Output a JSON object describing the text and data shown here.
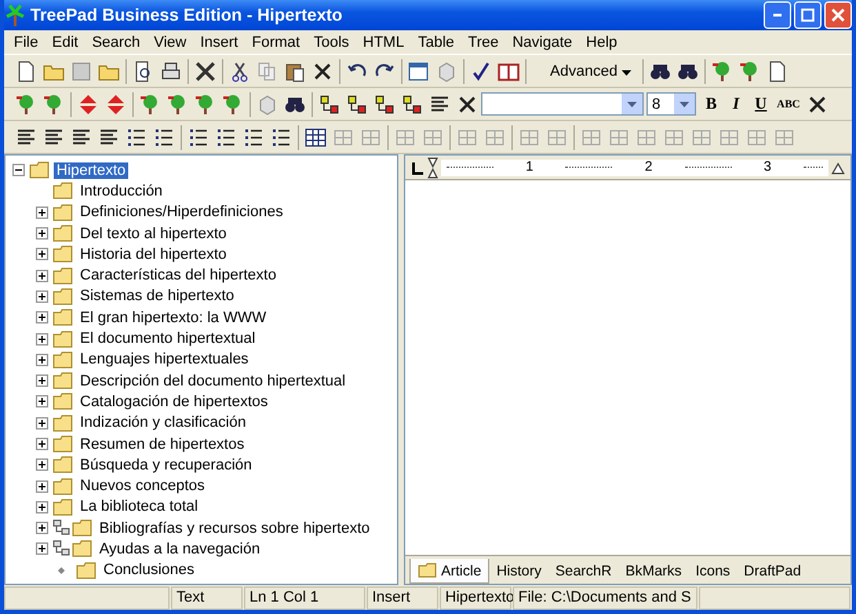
{
  "window": {
    "title": "TreePad Business Edition - Hipertexto"
  },
  "menu": [
    "File",
    "Edit",
    "Search",
    "View",
    "Insert",
    "Format",
    "Tools",
    "HTML",
    "Table",
    "Tree",
    "Navigate",
    "Help"
  ],
  "toolbar": {
    "search_mode": "Advanced",
    "font_size": "8",
    "bold": "B",
    "italic": "I",
    "underline": "U",
    "caps": "ABC"
  },
  "tree": {
    "label": "Hipertexto",
    "selected": true,
    "expanded": true,
    "children": [
      {
        "label": "Introducción",
        "kind": "plain",
        "selected": false
      },
      {
        "label": "Definiciones/Hiperdefiniciones",
        "kind": "folder",
        "selected": false
      },
      {
        "label": "Del texto al hipertexto",
        "kind": "folder",
        "selected": false
      },
      {
        "label": "Historia del hipertexto",
        "kind": "folder",
        "selected": false
      },
      {
        "label": "Características del hipertexto",
        "kind": "folder",
        "selected": false
      },
      {
        "label": "Sistemas de hipertexto",
        "kind": "folder",
        "selected": false
      },
      {
        "label": "El gran hipertexto: la WWW",
        "kind": "folder",
        "selected": false
      },
      {
        "label": "El documento hipertextual",
        "kind": "folder",
        "selected": false
      },
      {
        "label": "Lenguajes hipertextuales",
        "kind": "folder",
        "selected": false
      },
      {
        "label": "Descripción del documento hipertextual",
        "kind": "folder",
        "selected": false
      },
      {
        "label": "Catalogación de hipertextos",
        "kind": "folder",
        "selected": false
      },
      {
        "label": "Indización y clasificación",
        "kind": "folder",
        "selected": false
      },
      {
        "label": "Resumen de hipertextos",
        "kind": "folder",
        "selected": false
      },
      {
        "label": "Búsqueda y recuperación",
        "kind": "folder",
        "selected": false
      },
      {
        "label": "Nuevos conceptos",
        "kind": "folder",
        "selected": false
      },
      {
        "label": "La biblioteca total",
        "kind": "folder",
        "selected": false
      },
      {
        "label": "Bibliografías y recursos sobre hipertexto",
        "kind": "linked",
        "selected": false
      },
      {
        "label": "Ayudas a la navegación",
        "kind": "linked",
        "selected": false
      },
      {
        "label": "Conclusiones",
        "kind": "bullet",
        "selected": false
      }
    ]
  },
  "ruler": {
    "marks": [
      "1",
      "2",
      "3"
    ]
  },
  "tabs": [
    {
      "label": "Article",
      "selected": true
    },
    {
      "label": "History",
      "selected": false
    },
    {
      "label": "SearchR",
      "selected": false
    },
    {
      "label": "BkMarks",
      "selected": false
    },
    {
      "label": "Icons",
      "selected": false
    },
    {
      "label": "DraftPad",
      "selected": false
    }
  ],
  "status_bar": {
    "mode": "Text",
    "position": "Ln 1  Col 1",
    "insert": "Insert",
    "node": "Hipertexto",
    "file": "File: C:\\Documents and S"
  }
}
